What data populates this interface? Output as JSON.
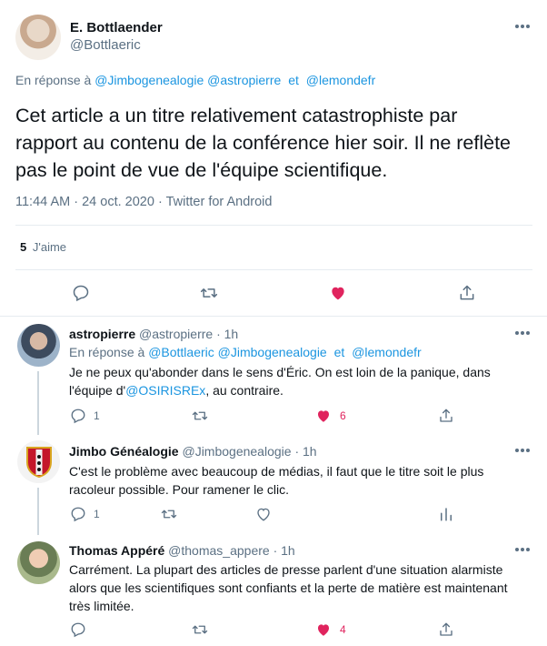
{
  "main": {
    "author_name": "E. Bottlaender",
    "author_handle": "@Bottlaeric",
    "reply_prefix": "En réponse à",
    "reply_to": [
      "@Jimbogenealogie",
      "@astropierre",
      "@lemondefr"
    ],
    "conjunction": "et",
    "text": "Cet article a un titre relativement catastrophiste par rapport au contenu de la conférence hier soir. Il ne reflète pas le point de vue de l'équipe scientifique.",
    "time": "11:44 AM",
    "date": "24 oct. 2020",
    "source": "Twitter for Android",
    "likes_count": "5",
    "likes_label": "J'aime"
  },
  "replies": [
    {
      "name": "astropierre",
      "handle": "@astropierre",
      "time": "1h",
      "reply_prefix": "En réponse à",
      "reply_to": [
        "@Bottlaeric",
        "@Jimbogenealogie",
        "@lemondefr"
      ],
      "conjunction": "et",
      "text_before": "Je ne peux qu'abonder dans le sens d'Éric. On est loin de la panique, dans l'équipe d'",
      "text_link": "@OSIRISREx",
      "text_after": ", au contraire.",
      "reply_count": "1",
      "like_count": "6"
    },
    {
      "name": "Jimbo Généalogie",
      "handle": "@Jimbogenealogie",
      "time": "1h",
      "text": "C'est le problème avec beaucoup de médias, il faut que le titre soit le plus racoleur possible. Pour ramener le clic.",
      "reply_count": "1"
    },
    {
      "name": "Thomas Appéré",
      "handle": "@thomas_appere",
      "time": "1h",
      "text": "Carrément. La plupart des articles de presse parlent d'une situation alarmiste alors que les scientifiques sont confiants et la perte de matière est maintenant très limitée.",
      "like_count": "4"
    }
  ],
  "separator": "·",
  "colors": {
    "link": "#1b95e0",
    "like": "#e0245e",
    "muted": "#5b7083",
    "border": "#e6ecf0"
  },
  "icons": [
    "more-icon",
    "reply-icon",
    "retweet-icon",
    "like-icon",
    "share-icon",
    "analytics-icon"
  ]
}
